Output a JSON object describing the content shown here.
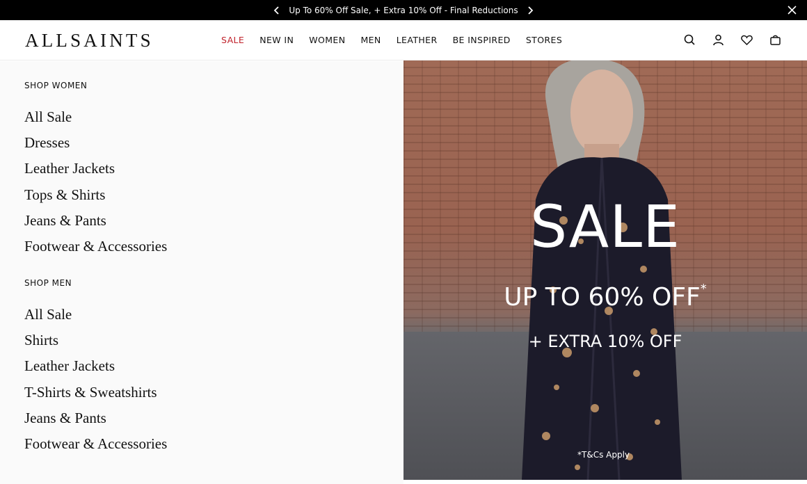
{
  "promo": {
    "message": "Up To 60% Off Sale, + Extra 10% Off - Final Reductions"
  },
  "header": {
    "logo": "ALLSAINTS",
    "nav": [
      "SALE",
      "NEW IN",
      "WOMEN",
      "MEN",
      "LEATHER",
      "BE INSPIRED",
      "STORES"
    ],
    "active_nav_color": "#c0222b",
    "icons": [
      "search-icon",
      "account-icon",
      "wishlist-heart-icon",
      "shopping-bag-icon"
    ]
  },
  "menu": {
    "women": {
      "title": "SHOP WOMEN",
      "links": [
        "All Sale",
        "Dresses",
        "Leather Jackets",
        "Tops & Shirts",
        "Jeans & Pants",
        "Footwear & Accessories"
      ]
    },
    "men": {
      "title": "SHOP MEN",
      "links": [
        "All Sale",
        "Shirts",
        "Leather Jackets",
        "T-Shirts & Sweatshirts",
        "Jeans & Pants",
        "Footwear & Accessories"
      ]
    }
  },
  "hero": {
    "title": "SALE",
    "subtitle": "UP TO 60% OFF",
    "subtitle_mark": "*",
    "extra": "+ EXTRA 10% OFF",
    "terms": "*T&Cs Apply"
  }
}
